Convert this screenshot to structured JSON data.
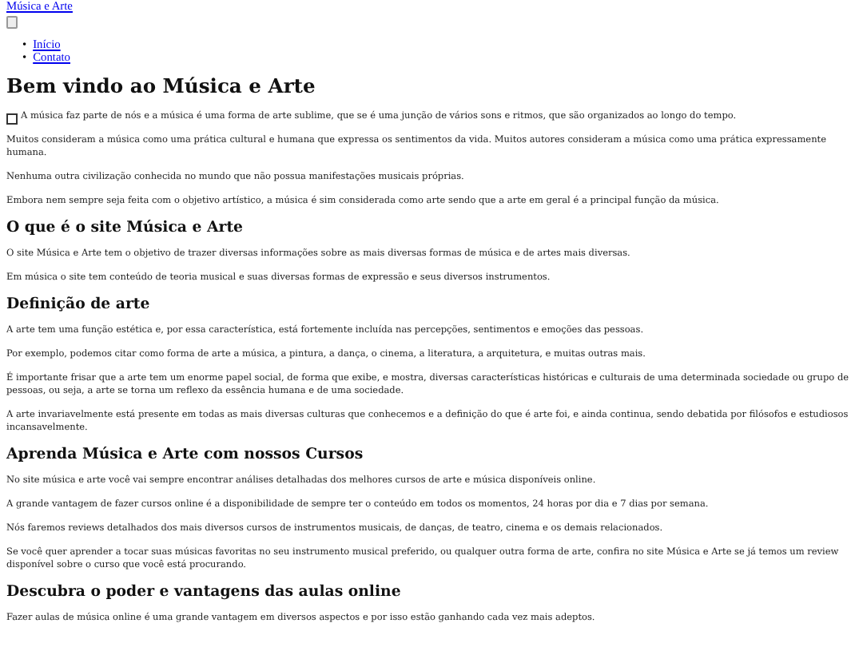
{
  "site_link": "Música e Arte",
  "nav": {
    "items": [
      {
        "marker": "•",
        "label": "Início"
      },
      {
        "marker": "•",
        "label": "Contato"
      }
    ]
  },
  "page_title": "Bem vindo ao Música e Arte",
  "intro": [
    "A música faz parte de nós e a música é uma forma de arte sublime, que se é uma junção de vários sons e ritmos, que são organizados ao longo do tempo.",
    "Muitos consideram a música como uma prática cultural e humana que expressa os sentimentos da vida. Muitos autores consideram a música como uma prática expressamente humana.",
    "Nenhuma outra civilização conhecida no mundo que não possua manifestações musicais próprias.",
    "Embora nem sempre seja feita com o objetivo artístico, a música é sim considerada como arte sendo que a arte em geral é a principal função da música."
  ],
  "sections": [
    {
      "heading": "O que é o site Música e Arte",
      "paragraphs": [
        "O site Música e Arte tem o objetivo de trazer diversas informações sobre as mais diversas formas de música e de artes mais diversas.",
        "Em música o site tem conteúdo de teoria musical e suas diversas formas de expressão e seus diversos instrumentos."
      ]
    },
    {
      "heading": "Definição de arte",
      "paragraphs": [
        "A arte tem uma função estética e, por essa característica, está fortemente incluída nas percepções, sentimentos e emoções das pessoas.",
        "Por exemplo, podemos citar como forma de arte a música, a pintura, a dança, o cinema, a literatura, a arquitetura, e muitas outras mais.",
        "É importante frisar que a arte tem um enorme papel social, de forma que exibe, e mostra, diversas características históricas e culturais de uma determinada sociedade ou grupo de pessoas, ou seja, a arte se torna um reflexo da essência humana e de uma sociedade.",
        "A arte invariavelmente está presente em todas as mais diversas culturas que conhecemos e a definição do que é arte foi, e ainda continua, sendo debatida por filósofos e estudiosos incansavelmente."
      ]
    },
    {
      "heading": "Aprenda Música e Arte com nossos Cursos",
      "paragraphs": [
        "No site música e arte você vai sempre encontrar análises detalhadas dos melhores cursos de arte e música disponíveis online.",
        "A grande vantagem de fazer cursos online é a disponibilidade de sempre ter o conteúdo em todos os momentos, 24 horas por dia e 7 dias por semana.",
        "Nós faremos reviews detalhados dos mais diversos cursos de instrumentos musicais, de danças, de teatro, cinema e os demais relacionados.",
        "Se você quer aprender a tocar suas músicas favoritas no seu instrumento musical preferido, ou qualquer outra forma de arte, confira no site Música e Arte se já temos um review disponível sobre o curso que você está procurando."
      ]
    },
    {
      "heading": "Descubra o poder e vantagens das aulas online",
      "paragraphs": [
        "Fazer aulas de música online é uma grande vantagem em diversos aspectos e por isso estão ganhando cada vez mais adeptos."
      ]
    }
  ]
}
